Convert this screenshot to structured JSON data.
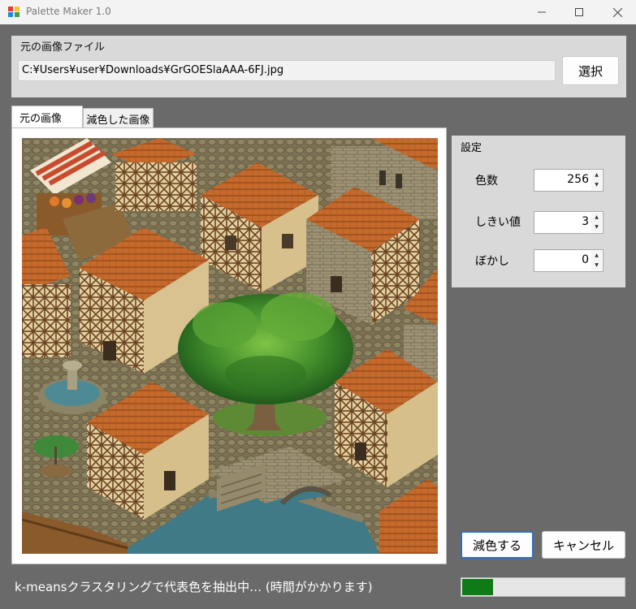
{
  "window": {
    "title": "Palette Maker 1.0"
  },
  "source_file": {
    "group_label": "元の画像ファイル",
    "path_value": "C:¥Users¥user¥Downloads¥GrGOESlaAAA-6FJ.jpg",
    "select_button": "選択"
  },
  "tabs": [
    {
      "label": "元の画像",
      "selected": true
    },
    {
      "label": "減色した画像",
      "selected": false
    }
  ],
  "settings": {
    "title": "設定",
    "fields": [
      {
        "label": "色数",
        "value": "256"
      },
      {
        "label": "しきい値",
        "value": "3"
      },
      {
        "label": "ぼかし",
        "value": "0"
      }
    ]
  },
  "actions": {
    "reduce_button": "減色する",
    "cancel_button": "キャンセル"
  },
  "status": {
    "message": "k-meansクラスタリングで代表色を抽出中… (時間がかかります)",
    "progress_fraction": 0.19
  },
  "colors": {
    "progress_fill": "#0f7b17",
    "default_button_border": "#2f6fbf",
    "background": "#6a6a6a",
    "group_background": "#d9d9d9"
  },
  "icons": {
    "app": "palette-app-icon",
    "minimize": "minimize-icon",
    "maximize": "maximize-icon",
    "close": "close-icon",
    "spin_up": "spin-up-arrow-icon",
    "spin_down": "spin-down-arrow-icon"
  }
}
